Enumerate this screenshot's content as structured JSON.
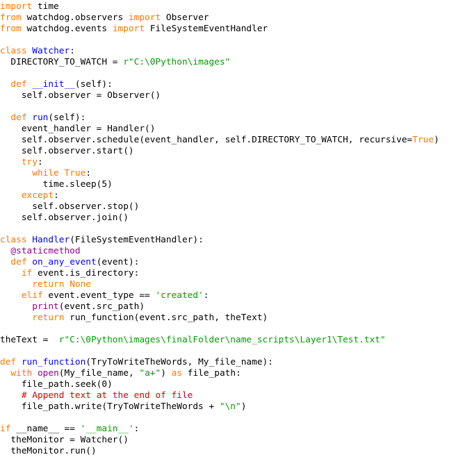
{
  "document": {
    "kind": "source-code-listing",
    "language": "python",
    "background_color": "#ffffff",
    "default_text_color": "#000000",
    "syntax_colors": {
      "keyword": "#ff7700",
      "definition_name": "#0000ff",
      "string": "#00a000",
      "builtin": "#900090",
      "decorator": "#900090",
      "comment": "#dd0000",
      "plain": "#000000"
    },
    "plain_text": "import time\nfrom watchdog.observers import Observer\nfrom watchdog.events import FileSystemEventHandler\n\nclass Watcher:\n  DIRECTORY_TO_WATCH = r\"C:\\0Python\\images\"\n\n  def __init__(self):\n    self.observer = Observer()\n\n  def run(self):\n    event_handler = Handler()\n    self.observer.schedule(event_handler, self.DIRECTORY_TO_WATCH, recursive=True)\n    self.observer.start()\n    try:\n      while True:\n        time.sleep(5)\n    except:\n      self.observer.stop()\n    self.observer.join()\n\nclass Handler(FileSystemEventHandler):\n  @staticmethod\n  def on_any_event(event):\n    if event.is_directory:\n      return None\n    elif event.event_type == 'created':\n      print(event.src_path)\n      return run_function(event.src_path, theText)\n\ntheText =  r\"C:\\0Python\\images\\finalFolder\\name_scripts\\Layer1\\Test.txt\"\n\ndef run_function(TryToWriteTheWords, My_file_name):\n  with open(My_file_name, \"a+\") as file_path:\n    file_path.seek(0)\n    # Append text at the end of file\n    file_path.write(TryToWriteTheWords + \"\\n\")\n\nif __name__ == '__main__':\n  theMonitor = Watcher()\n  theMonitor.run()",
    "lines": [
      [
        {
          "t": "import",
          "c": "kw"
        },
        {
          "t": " time",
          "c": "plain"
        }
      ],
      [
        {
          "t": "from",
          "c": "kw"
        },
        {
          "t": " watchdog.observers ",
          "c": "plain"
        },
        {
          "t": "import",
          "c": "kw"
        },
        {
          "t": " Observer",
          "c": "plain"
        }
      ],
      [
        {
          "t": "from",
          "c": "kw"
        },
        {
          "t": " watchdog.events ",
          "c": "plain"
        },
        {
          "t": "import",
          "c": "kw"
        },
        {
          "t": " FileSystemEventHandler",
          "c": "plain"
        }
      ],
      [],
      [
        {
          "t": "class",
          "c": "kw"
        },
        {
          "t": " ",
          "c": "plain"
        },
        {
          "t": "Watcher",
          "c": "name"
        },
        {
          "t": ":",
          "c": "plain"
        }
      ],
      [
        {
          "t": "  DIRECTORY_TO_WATCH = ",
          "c": "plain"
        },
        {
          "t": "r\"C:\\0Python\\images\"",
          "c": "str"
        }
      ],
      [],
      [
        {
          "t": "  ",
          "c": "plain"
        },
        {
          "t": "def",
          "c": "kw"
        },
        {
          "t": " ",
          "c": "plain"
        },
        {
          "t": "__init__",
          "c": "name"
        },
        {
          "t": "(self):",
          "c": "plain"
        }
      ],
      [
        {
          "t": "    self.observer = Observer()",
          "c": "plain"
        }
      ],
      [],
      [
        {
          "t": "  ",
          "c": "plain"
        },
        {
          "t": "def",
          "c": "kw"
        },
        {
          "t": " ",
          "c": "plain"
        },
        {
          "t": "run",
          "c": "name"
        },
        {
          "t": "(self):",
          "c": "plain"
        }
      ],
      [
        {
          "t": "    event_handler = Handler()",
          "c": "plain"
        }
      ],
      [
        {
          "t": "    self.observer.schedule(event_handler, self.DIRECTORY_TO_WATCH, recursive=",
          "c": "plain"
        },
        {
          "t": "True",
          "c": "kw"
        },
        {
          "t": ")",
          "c": "plain"
        }
      ],
      [
        {
          "t": "    self.observer.start()",
          "c": "plain"
        }
      ],
      [
        {
          "t": "    ",
          "c": "plain"
        },
        {
          "t": "try",
          "c": "kw"
        },
        {
          "t": ":",
          "c": "plain"
        }
      ],
      [
        {
          "t": "      ",
          "c": "plain"
        },
        {
          "t": "while",
          "c": "kw"
        },
        {
          "t": " ",
          "c": "plain"
        },
        {
          "t": "True",
          "c": "kw"
        },
        {
          "t": ":",
          "c": "plain"
        }
      ],
      [
        {
          "t": "        time.sleep(5)",
          "c": "plain"
        }
      ],
      [
        {
          "t": "    ",
          "c": "plain"
        },
        {
          "t": "except",
          "c": "kw"
        },
        {
          "t": ":",
          "c": "plain"
        }
      ],
      [
        {
          "t": "      self.observer.stop()",
          "c": "plain"
        }
      ],
      [
        {
          "t": "    self.observer.join()",
          "c": "plain"
        }
      ],
      [],
      [
        {
          "t": "class",
          "c": "kw"
        },
        {
          "t": " ",
          "c": "plain"
        },
        {
          "t": "Handler",
          "c": "name"
        },
        {
          "t": "(FileSystemEventHandler):",
          "c": "plain"
        }
      ],
      [
        {
          "t": "  ",
          "c": "plain"
        },
        {
          "t": "@staticmethod",
          "c": "deco"
        }
      ],
      [
        {
          "t": "  ",
          "c": "plain"
        },
        {
          "t": "def",
          "c": "kw"
        },
        {
          "t": " ",
          "c": "plain"
        },
        {
          "t": "on_any_event",
          "c": "name"
        },
        {
          "t": "(event):",
          "c": "plain"
        }
      ],
      [
        {
          "t": "    ",
          "c": "plain"
        },
        {
          "t": "if",
          "c": "kw"
        },
        {
          "t": " event.is_directory:",
          "c": "plain"
        }
      ],
      [
        {
          "t": "      ",
          "c": "plain"
        },
        {
          "t": "return",
          "c": "kw"
        },
        {
          "t": " ",
          "c": "plain"
        },
        {
          "t": "None",
          "c": "kw"
        }
      ],
      [
        {
          "t": "    ",
          "c": "plain"
        },
        {
          "t": "elif",
          "c": "kw"
        },
        {
          "t": " event.event_type == ",
          "c": "plain"
        },
        {
          "t": "'created'",
          "c": "str"
        },
        {
          "t": ":",
          "c": "plain"
        }
      ],
      [
        {
          "t": "      ",
          "c": "plain"
        },
        {
          "t": "print",
          "c": "builtin"
        },
        {
          "t": "(event.src_path)",
          "c": "plain"
        }
      ],
      [
        {
          "t": "      ",
          "c": "plain"
        },
        {
          "t": "return",
          "c": "kw"
        },
        {
          "t": " run_function(event.src_path, theText)",
          "c": "plain"
        }
      ],
      [],
      [
        {
          "t": "theText =  ",
          "c": "plain"
        },
        {
          "t": "r\"C:\\0Python\\images\\finalFolder\\name_scripts\\Layer1\\Test.txt\"",
          "c": "str"
        }
      ],
      [],
      [
        {
          "t": "def",
          "c": "kw"
        },
        {
          "t": " ",
          "c": "plain"
        },
        {
          "t": "run_function",
          "c": "name"
        },
        {
          "t": "(TryToWriteTheWords, My_file_name):",
          "c": "plain"
        }
      ],
      [
        {
          "t": "  ",
          "c": "plain"
        },
        {
          "t": "with",
          "c": "kw"
        },
        {
          "t": " ",
          "c": "plain"
        },
        {
          "t": "open",
          "c": "builtin"
        },
        {
          "t": "(My_file_name, ",
          "c": "plain"
        },
        {
          "t": "\"a+\"",
          "c": "str"
        },
        {
          "t": ") ",
          "c": "plain"
        },
        {
          "t": "as",
          "c": "kw"
        },
        {
          "t": " file_path:",
          "c": "plain"
        }
      ],
      [
        {
          "t": "    file_path.seek(0)",
          "c": "plain"
        }
      ],
      [
        {
          "t": "    ",
          "c": "plain"
        },
        {
          "t": "# Append text at the end of file",
          "c": "comment"
        }
      ],
      [
        {
          "t": "    file_path.write(TryToWriteTheWords + ",
          "c": "plain"
        },
        {
          "t": "\"\\n\"",
          "c": "str"
        },
        {
          "t": ")",
          "c": "plain"
        }
      ],
      [],
      [
        {
          "t": "if",
          "c": "kw"
        },
        {
          "t": " ",
          "c": "plain"
        },
        {
          "t": "__name__",
          "c": "plain"
        },
        {
          "t": " == ",
          "c": "plain"
        },
        {
          "t": "'__main__'",
          "c": "str"
        },
        {
          "t": ":",
          "c": "plain"
        }
      ],
      [
        {
          "t": "  theMonitor = Watcher()",
          "c": "plain"
        }
      ],
      [
        {
          "t": "  theMonitor.run()",
          "c": "plain"
        }
      ]
    ]
  }
}
